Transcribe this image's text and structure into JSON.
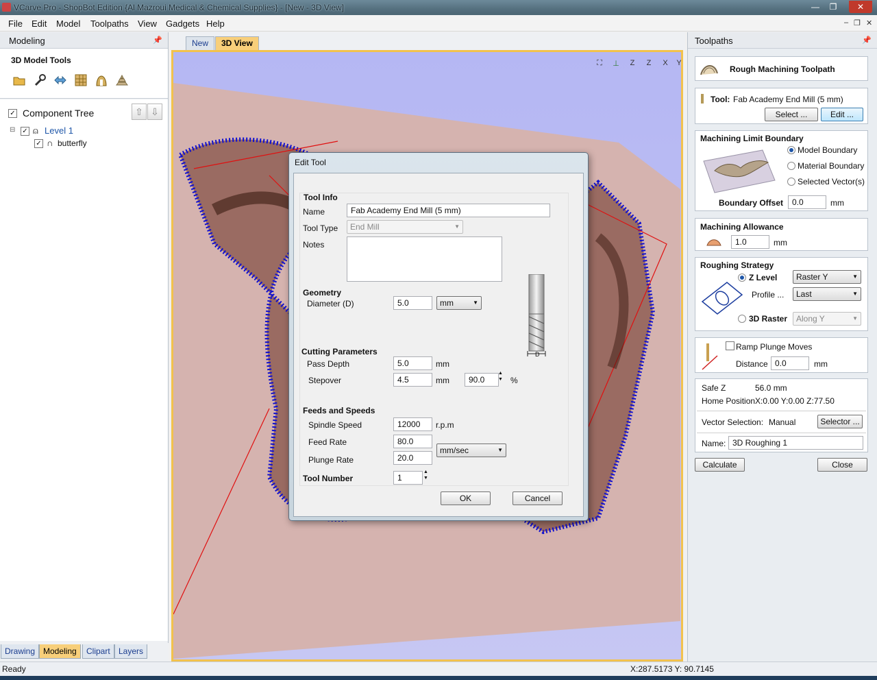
{
  "window": {
    "title": "VCarve Pro - ShopBot Edition {Al Mazroui Medical & Chemical Supplies} - [New - 3D View]",
    "controls": [
      "—",
      "❐",
      "✕"
    ]
  },
  "menu": [
    "File",
    "Edit",
    "Model",
    "Toolpaths",
    "View",
    "Gadgets",
    "Help"
  ],
  "mdi_controls": [
    "–",
    "❐",
    "✕"
  ],
  "left_panel": {
    "header": "Modeling",
    "tools_title": "3D Model Tools",
    "tool_icons": [
      "open-folder-icon",
      "wrench-icon",
      "transform-icon",
      "texture-icon",
      "weld-icon",
      "stack-icon"
    ],
    "component_tree": {
      "title": "Component Tree",
      "items": [
        {
          "label": "Level 1",
          "expand": "⊟"
        },
        {
          "label": "butterfly"
        }
      ]
    },
    "bottom_tabs": [
      "Drawing",
      "Modeling",
      "Clipart",
      "Layers"
    ],
    "active_bottom_tab": "Modeling"
  },
  "doc_tabs": [
    "New",
    "3D View"
  ],
  "active_doc_tab": "3D View",
  "view_icons": [
    "⛶",
    "Z",
    "Z",
    "X",
    "Y"
  ],
  "right_panel": {
    "header": "Toolpaths",
    "toolpath_title": "Rough Machining Toolpath",
    "tool": {
      "label": "Tool:",
      "value": "Fab Academy End Mill (5 mm)",
      "select_btn": "Select ...",
      "edit_btn": "Edit ..."
    },
    "boundary": {
      "title": "Machining Limit Boundary",
      "options": [
        "Model Boundary",
        "Material Boundary",
        "Selected Vector(s)"
      ],
      "selected": "Model Boundary",
      "offset_label": "Boundary Offset",
      "offset_value": "0.0",
      "offset_unit": "mm"
    },
    "allowance": {
      "title": "Machining Allowance",
      "value": "1.0",
      "unit": "mm"
    },
    "strategy": {
      "title": "Roughing Strategy",
      "zlevel_label": "Z Level",
      "zlevel_value": "Raster Y",
      "profile_label": "Profile ...",
      "profile_value": "Last",
      "raster_label": "3D Raster",
      "raster_value": "Along Y"
    },
    "ramp": {
      "label": "Ramp Plunge Moves",
      "distance_label": "Distance",
      "distance_value": "0.0",
      "unit": "mm"
    },
    "info": {
      "safe_z_label": "Safe Z",
      "safe_z_value": "56.0 mm",
      "home_label": "Home Position",
      "home_value": "X:0.00 Y:0.00 Z:77.50",
      "vector_label": "Vector Selection:",
      "vector_value": "Manual",
      "selector_btn": "Selector ...",
      "name_label": "Name:",
      "name_value": "3D Roughing 1"
    },
    "calculate_btn": "Calculate",
    "close_btn": "Close"
  },
  "status": {
    "left": "Ready",
    "coords": "X:287.5173 Y: 90.7145"
  },
  "dialog": {
    "title": "Edit Tool",
    "tool_info": "Tool Info",
    "name_label": "Name",
    "name_value": "Fab Academy End Mill (5 mm)",
    "type_label": "Tool Type",
    "type_value": "End Mill",
    "notes_label": "Notes",
    "notes_value": "",
    "geometry": "Geometry",
    "diameter_label": "Diameter (D)",
    "diameter_value": "5.0",
    "diameter_unit": "mm",
    "tool_image_label": "D",
    "cutting": "Cutting Parameters",
    "pass_depth_label": "Pass Depth",
    "pass_depth_value": "5.0",
    "pass_depth_unit": "mm",
    "stepover_label": "Stepover",
    "stepover_value": "4.5",
    "stepover_unit": "mm",
    "stepover_pct": "90.0",
    "pct_symbol": "%",
    "feeds": "Feeds and Speeds",
    "spindle_label": "Spindle Speed",
    "spindle_value": "12000",
    "spindle_unit": "r.p.m",
    "feed_label": "Feed Rate",
    "feed_value": "80.0",
    "plunge_label": "Plunge Rate",
    "plunge_value": "20.0",
    "rate_unit": "mm/sec",
    "tool_number_label": "Tool Number",
    "tool_number_value": "1",
    "ok": "OK",
    "cancel": "Cancel"
  }
}
